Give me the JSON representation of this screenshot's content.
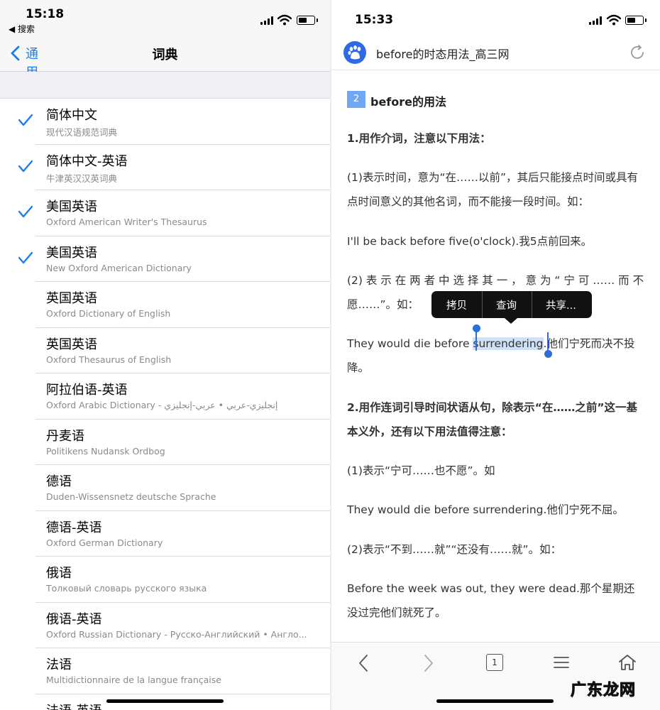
{
  "left": {
    "status": {
      "time": "15:18",
      "back_app": "◀ 搜索"
    },
    "nav": {
      "back_label": "通用",
      "title": "词典"
    },
    "dictionaries": [
      {
        "name": "简体中文",
        "subtitle": "现代汉语规范词典",
        "checked": true
      },
      {
        "name": "简体中文-英语",
        "subtitle": "牛津英汉汉英词典",
        "checked": true
      },
      {
        "name": "美国英语",
        "subtitle": "Oxford American Writer's Thesaurus",
        "checked": true
      },
      {
        "name": "美国英语",
        "subtitle": "New Oxford American Dictionary",
        "checked": true
      },
      {
        "name": "英国英语",
        "subtitle": "Oxford Dictionary of English",
        "checked": false
      },
      {
        "name": "英国英语",
        "subtitle": "Oxford Thesaurus of English",
        "checked": false
      },
      {
        "name": "阿拉伯语-英语",
        "subtitle": "Oxford Arabic Dictionary - إنجليزي-عربي • عربي-إنجليزي",
        "checked": false
      },
      {
        "name": "丹麦语",
        "subtitle": "Politikens Nudansk Ordbog",
        "checked": false
      },
      {
        "name": "德语",
        "subtitle": "Duden-Wissensnetz deutsche Sprache",
        "checked": false
      },
      {
        "name": "德语-英语",
        "subtitle": "Oxford German Dictionary",
        "checked": false
      },
      {
        "name": "俄语",
        "subtitle": "Толковый словарь русского языка",
        "checked": false
      },
      {
        "name": "俄语-英语",
        "subtitle": "Oxford Russian Dictionary - Русско-Английский • Англо...",
        "checked": false
      },
      {
        "name": "法语",
        "subtitle": "Multidictionnaire de la langue française",
        "checked": false
      },
      {
        "name": "法语-英语",
        "subtitle": "",
        "checked": false
      }
    ]
  },
  "right": {
    "status": {
      "time": "15:33"
    },
    "browser": {
      "page_title": "before的时态用法_高三网"
    },
    "article": {
      "section_number": "2",
      "section_title": "before的用法",
      "h1": "1.用作介词，注意以下用法：",
      "p1": "(1)表示时间，意为“在……以前”，其后只能接点时间或具有点时间意义的其他名词，而不能接一段时间。如：",
      "p2": "I'll be back before five(o'clock).我5点前回来。",
      "p3_line1": "(2) 表 示 在 两 者 中 选 择 其 一 ， 意 为 “ 宁 可 …… 而 不",
      "p3_line2": "愿……”。如：",
      "p4_before": "They would die before ",
      "p4_selected": "surrendering",
      "p4_after": ".他们宁死而决不投降。",
      "h2": "2.用作连词引导时间状语从句，除表示“在……之前”这一基本义外，还有以下用法值得注意：",
      "p5": "(1)表示“宁可……也不愿”。如",
      "p6": "They would die before surrendering.他们宁死不屈。",
      "p7": "(2)表示“不到……就”“还没有……就”。如：",
      "p8": "Before the week was out, they were dead.那个星期还没过完他们就死了。"
    },
    "context_menu": {
      "copy": "拷贝",
      "lookup": "查询",
      "share": "共享..."
    },
    "toolbar": {
      "tab_count": "1"
    },
    "watermark": "广东龙网"
  }
}
